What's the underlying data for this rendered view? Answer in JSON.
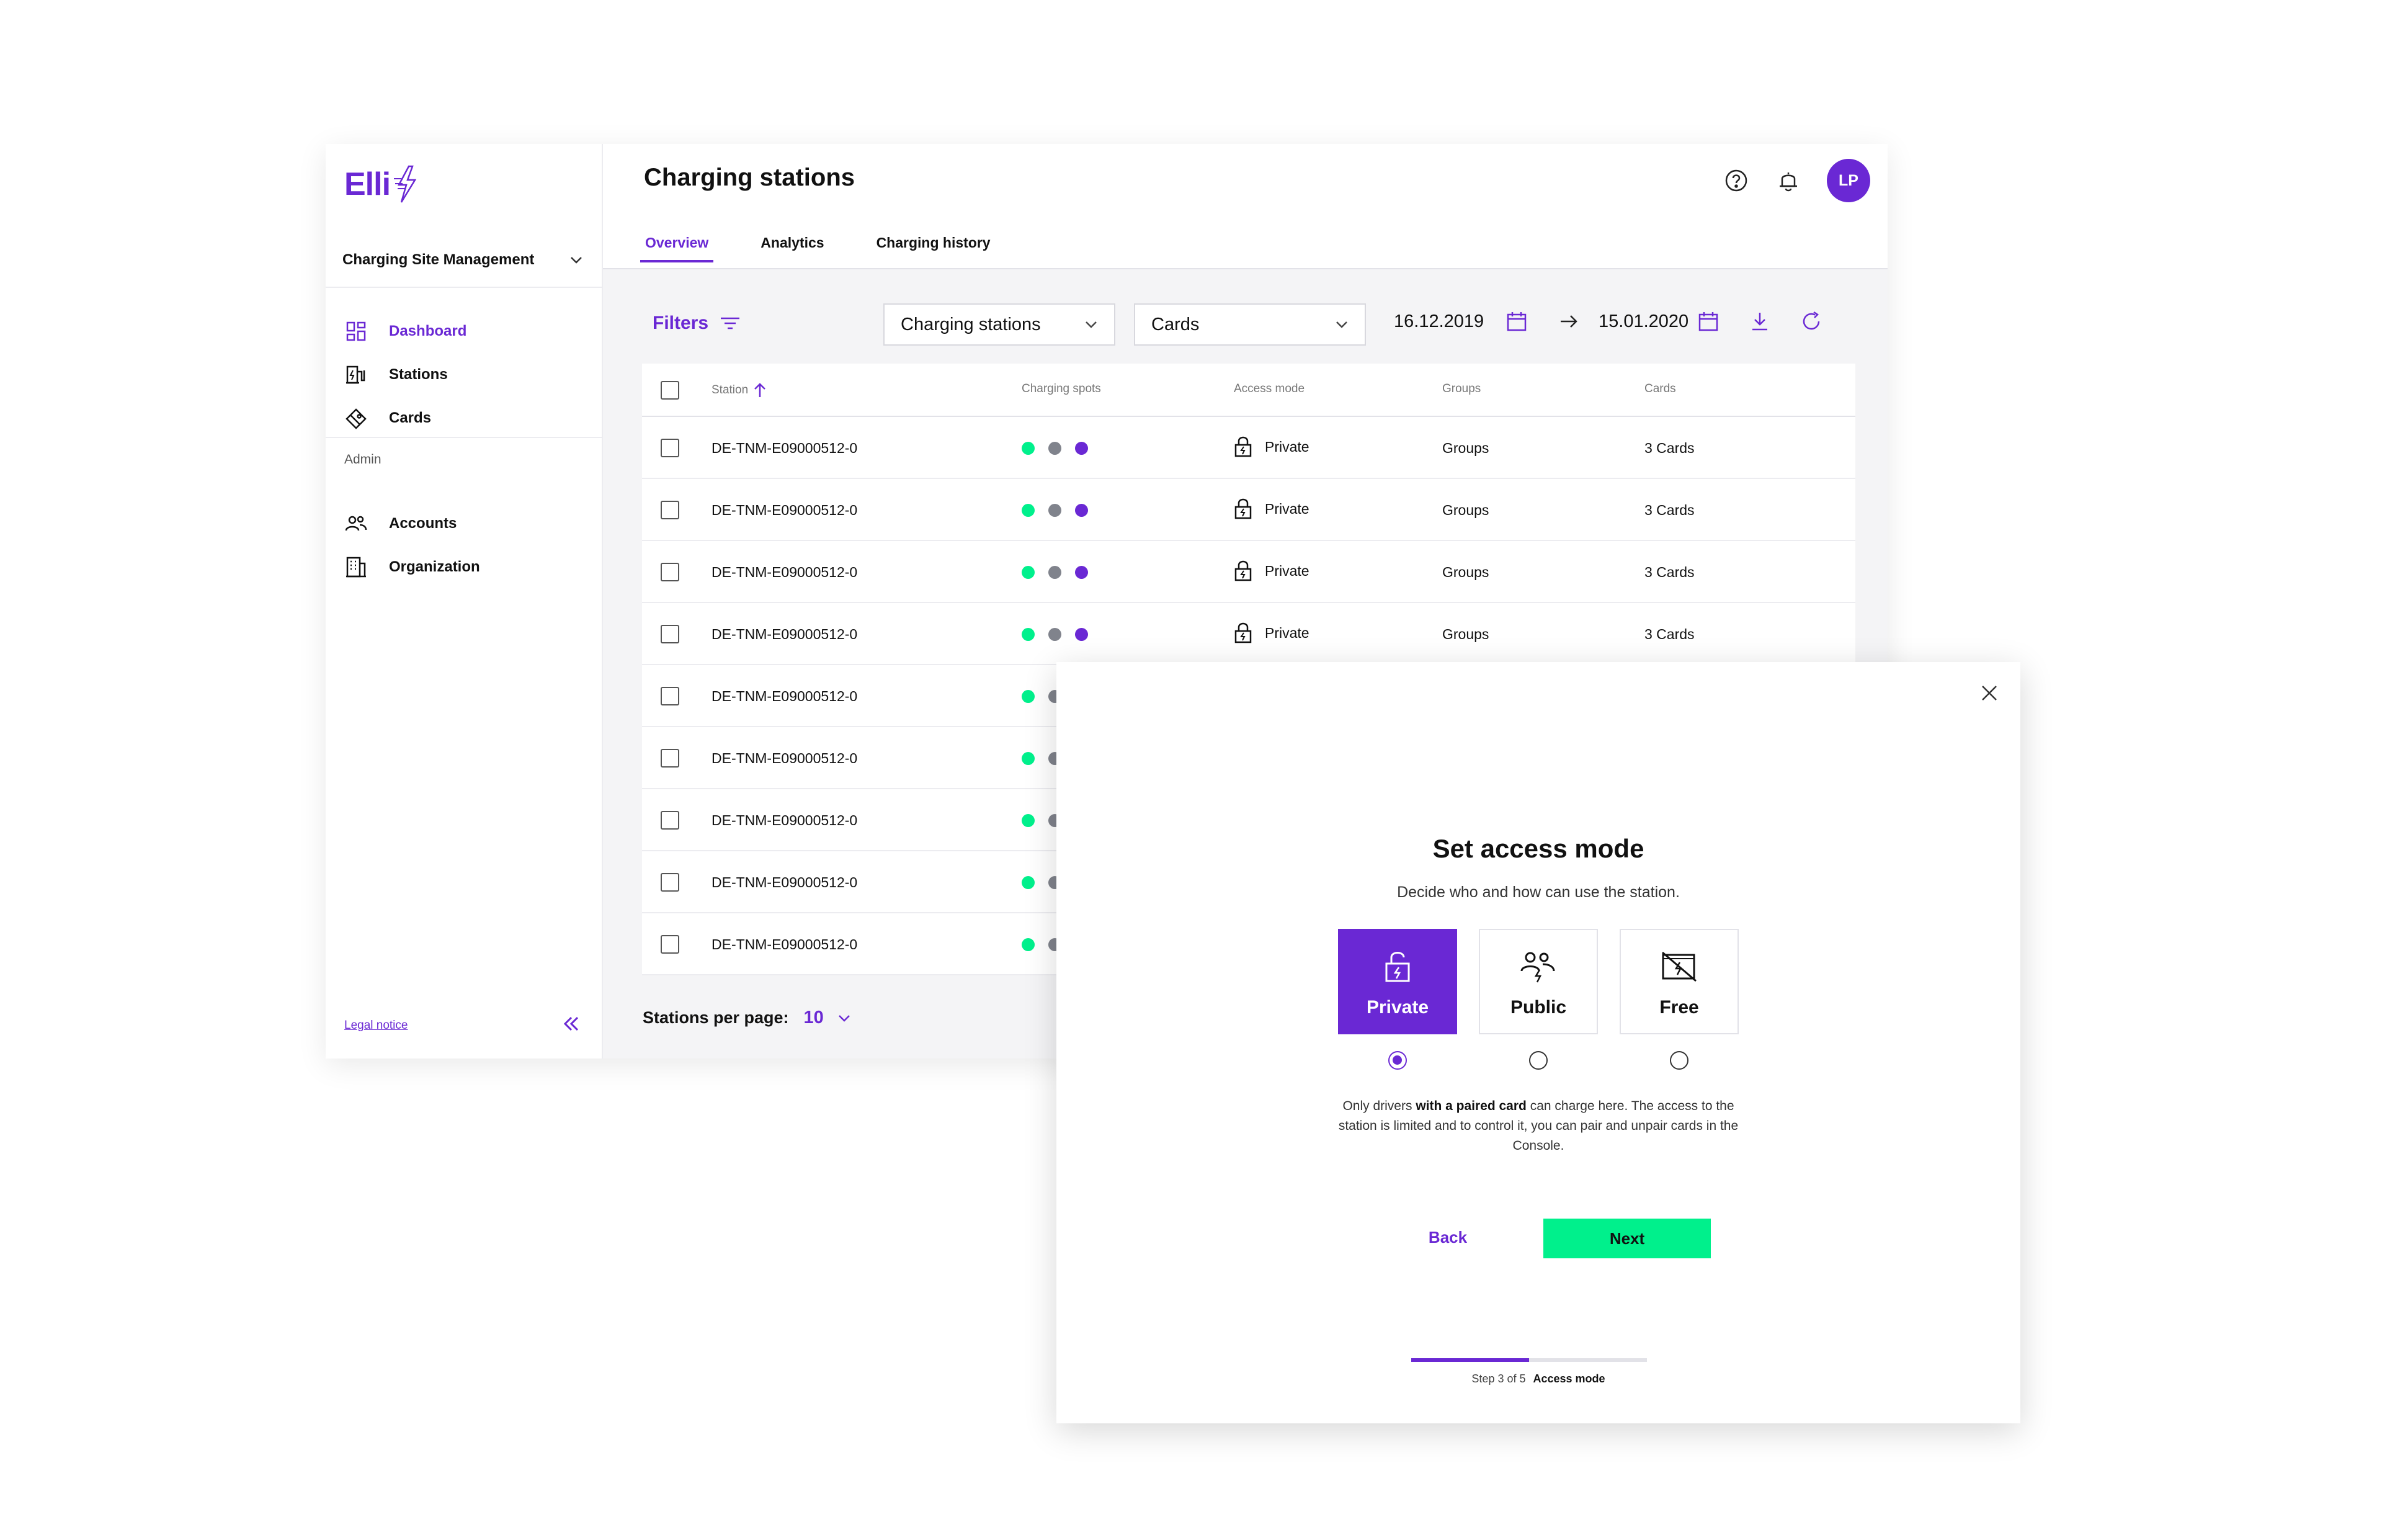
{
  "brand": {
    "logo_text": "Elli",
    "accent": "#6a28d4",
    "green": "#00f08c",
    "grey_dot": "#80838c"
  },
  "sidebar": {
    "site_selector": "Charging Site Management",
    "items": [
      {
        "label": "Dashboard",
        "icon": "dashboard-icon",
        "active": true
      },
      {
        "label": "Stations",
        "icon": "station-icon"
      },
      {
        "label": "Cards",
        "icon": "card-icon"
      }
    ],
    "admin_label": "Admin",
    "admin_items": [
      {
        "label": "Accounts",
        "icon": "users-icon"
      },
      {
        "label": "Organization",
        "icon": "building-icon"
      }
    ],
    "legal": "Legal notice"
  },
  "header": {
    "title": "Charging stations",
    "avatar_initials": "LP",
    "tabs": [
      {
        "label": "Overview",
        "active": true
      },
      {
        "label": "Analytics"
      },
      {
        "label": "Charging history"
      }
    ]
  },
  "toolbar": {
    "filters_label": "Filters",
    "station_select": "Charging stations",
    "cards_select": "Cards",
    "date_from": "16.12.2019",
    "date_to": "15.01.2020"
  },
  "table": {
    "columns": [
      "Station",
      "Charging spots",
      "Access mode",
      "Groups",
      "Cards"
    ],
    "rows": [
      {
        "station": "DE-TNM-E09000512-0",
        "access": "Private",
        "groups": "Groups",
        "cards": "3 Cards"
      },
      {
        "station": "DE-TNM-E09000512-0",
        "access": "Private",
        "groups": "Groups",
        "cards": "3 Cards"
      },
      {
        "station": "DE-TNM-E09000512-0",
        "access": "Private",
        "groups": "Groups",
        "cards": "3 Cards"
      },
      {
        "station": "DE-TNM-E09000512-0",
        "access": "Private",
        "groups": "Groups",
        "cards": "3 Cards"
      },
      {
        "station": "DE-TNM-E09000512-0"
      },
      {
        "station": "DE-TNM-E09000512-0"
      },
      {
        "station": "DE-TNM-E09000512-0"
      },
      {
        "station": "DE-TNM-E09000512-0"
      },
      {
        "station": "DE-TNM-E09000512-0"
      }
    ],
    "per_page_label": "Stations per page:",
    "per_page_value": "10"
  },
  "modal": {
    "title": "Set access mode",
    "subtitle": "Decide who and how can use the station.",
    "options": [
      {
        "label": "Private",
        "icon": "lock-icon",
        "selected": true
      },
      {
        "label": "Public",
        "icon": "users-bolt-icon"
      },
      {
        "label": "Free",
        "icon": "no-card-icon"
      }
    ],
    "desc_before": "Only drivers ",
    "desc_bold": "with a paired card",
    "desc_after": " can charge here. The access to the station is limited and to control it, you can pair and unpair cards in the Console.",
    "back_label": "Back",
    "next_label": "Next",
    "progress_fraction": 0.5,
    "step_text": "Step 3 of 5",
    "step_name": "Access mode"
  }
}
